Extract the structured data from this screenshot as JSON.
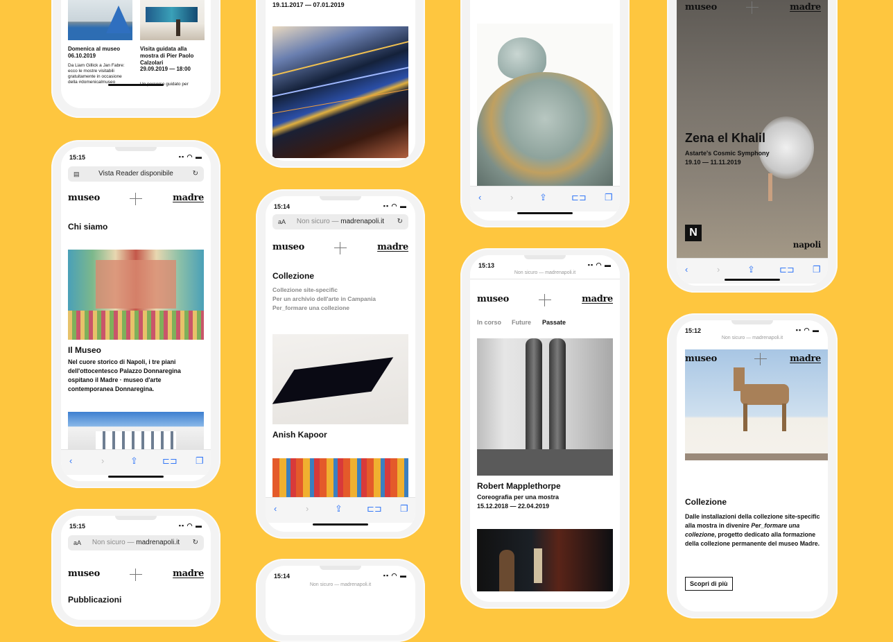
{
  "background_color": "#fec63f",
  "phone1": {
    "event1_title": "Domenica al museo",
    "event1_date": "06.10.2019",
    "event1_text": "Da Liam Gillick a Jan Fabre: ecco le mostre visitabili gratuitamente in occasione della #domenicalmuseo",
    "event2_title": "Visita guidata alla mostra di Pier Paolo Calzolari",
    "event2_date": "29.09.2019 — 18:00",
    "event2_text": "Un percorso guidato per"
  },
  "phone2": {
    "time": "15:15",
    "reader": "Vista Reader disponibile",
    "logo_left": "museo",
    "logo_right": "madre",
    "section": "Chi siamo",
    "title": "Il Museo",
    "text": "Nel cuore storico di Napoli, i tre piani dell'ottocentesco Palazzo Donnaregina ospitano il Madre · museo d'arte contemporanea Donnaregina."
  },
  "phone3": {
    "time": "15:15",
    "url_prefix": "Non sicuro —",
    "url": "madrenapoli.it",
    "logo_left": "museo",
    "logo_right": "madre",
    "section": "Pubblicazioni"
  },
  "phone4": {
    "date": "19.11.2017 — 07.01.2019"
  },
  "phone5": {
    "time": "15:14",
    "url_prefix": "Non sicuro —",
    "url": "madrenapoli.it",
    "logo_left": "museo",
    "logo_right": "madre",
    "section": "Collezione",
    "links": [
      "Collezione site-specific",
      "Per un archivio dell'arte in Campania",
      "Per_formare una collezione"
    ],
    "artist": "Anish Kapoor"
  },
  "phone6": {
    "time": "15:14",
    "url": "Non sicuro — madrenapoli.it"
  },
  "phone8": {
    "time": "15:13",
    "url": "Non sicuro — madrenapoli.it",
    "logo_left": "museo",
    "logo_right": "madre",
    "tabs": [
      "In corso",
      "Future",
      "Passate"
    ],
    "title": "Robert Mapplethorpe",
    "subtitle": "Coreografia per una mostra",
    "dates": "15.12.2018 — 22.04.2019"
  },
  "phone9": {
    "logo_left": "museo",
    "logo_right": "madre",
    "title": "Zena el Khalil",
    "subtitle": "Astarte's Cosmic Symphony",
    "dates": "19.10 — 11.11.2019",
    "city": "napoli"
  },
  "phone10": {
    "time": "15:12",
    "url": "Non sicuro — madrenapoli.it",
    "logo_left": "museo",
    "logo_right": "madre",
    "title": "Collezione",
    "text_a": "Dalle installazioni della collezione site-specific alla mostra in divenire",
    "text_em": "Per_formare una collezione",
    "text_b": ", progetto dedicato alla formazione della collezione permanente del museo Madre.",
    "button": "Scopri di più"
  }
}
